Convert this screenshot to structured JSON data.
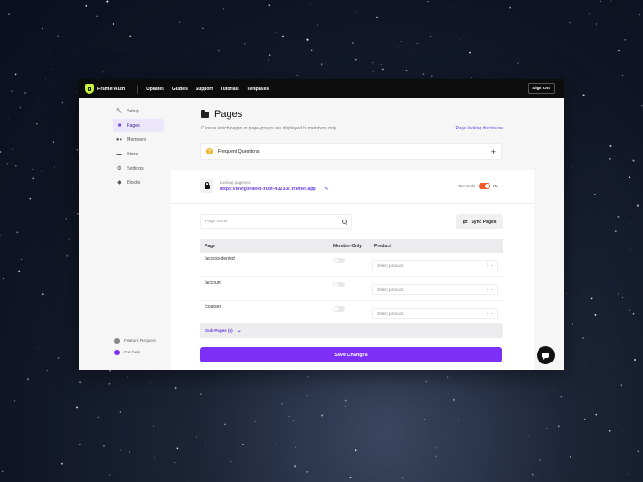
{
  "nav": {
    "brand": "FramerAuth",
    "links": [
      "Updates",
      "Guides",
      "Support",
      "Tutorials",
      "Templates"
    ],
    "signout": "Sign Out"
  },
  "sidebar": {
    "items": [
      {
        "label": "Setup",
        "icon": "wrench-icon"
      },
      {
        "label": "Pages",
        "icon": "folder-icon"
      },
      {
        "label": "Members",
        "icon": "members-icon"
      },
      {
        "label": "Store",
        "icon": "store-icon"
      },
      {
        "label": "Settings",
        "icon": "gear-icon"
      },
      {
        "label": "Blocks",
        "icon": "blocks-icon"
      }
    ],
    "active": "Pages",
    "footer": [
      {
        "label": "Feature Request",
        "icon": "bulb-icon"
      },
      {
        "label": "Get help",
        "icon": "help-icon"
      }
    ]
  },
  "main": {
    "title": "Pages",
    "subtitle": "Choose which pages or page-groups are displayed to members only",
    "disclosure": "Page locking disclosure",
    "faq": "Frequent Questions",
    "faq_icon": "?",
    "lock": {
      "label": "Locking pages to:",
      "url": "https://invigorated-trust-432337.framer.app",
      "test_mode_label": "Test mode",
      "test_mode_state": "On"
    },
    "search_placeholder": "Page name",
    "sync_label": "Sync Pages",
    "table": {
      "headers": [
        "Page",
        "Member-Only",
        "Product"
      ],
      "rows": [
        {
          "path": "/access-denied",
          "member_only": false,
          "product": "Select product"
        },
        {
          "path": "/account",
          "member_only": false,
          "product": "Select product"
        },
        {
          "path": "/courses",
          "member_only": false,
          "product": "Select product"
        }
      ],
      "subpages": "Sub-Pages (6)"
    },
    "save_label": "Save Changes"
  },
  "colors": {
    "accent": "#7b2ff7",
    "link": "#6b3fe0",
    "toggle_on": "#f05a28",
    "brand": "#c9f23a"
  }
}
